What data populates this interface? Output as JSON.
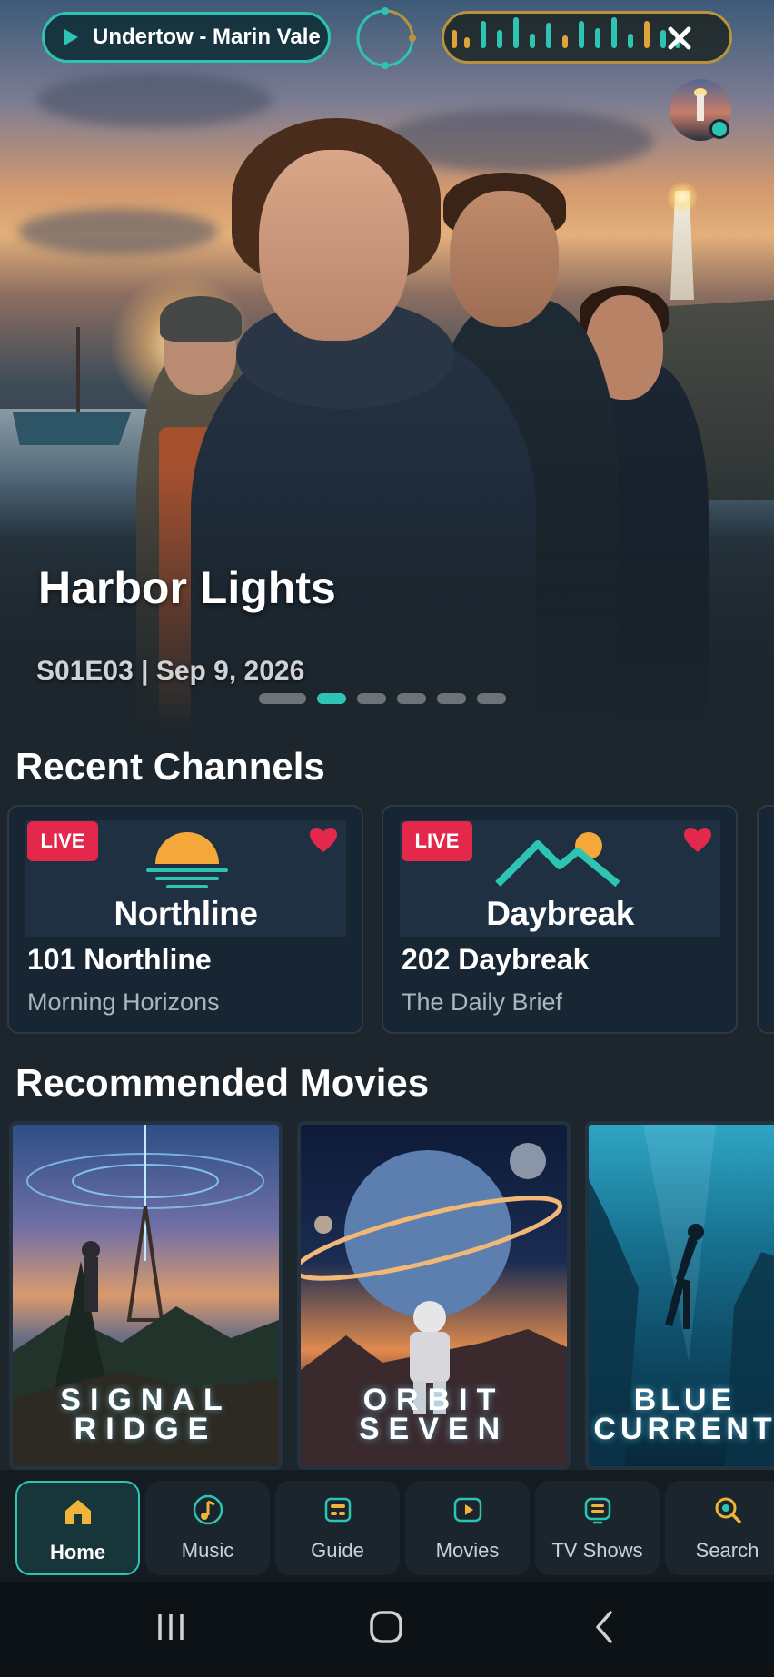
{
  "now_playing": {
    "text": "Undertow - Marin Vale",
    "accent": "#2ec4b3"
  },
  "hero": {
    "title": "Harbor Lights",
    "subtitle": "S01E03 | Sep 9, 2026",
    "carousel": {
      "count": 6,
      "active_index": 1
    }
  },
  "recent_channels": {
    "title": "Recent Channels",
    "items": [
      {
        "badge": "LIVE",
        "logo_text": "Northline",
        "number_name": "101  Northline",
        "show": "Morning Horizons",
        "favorite": true
      },
      {
        "badge": "LIVE",
        "logo_text": "Daybreak",
        "number_name": "202  Daybreak",
        "show": "The Daily Brief",
        "favorite": true
      }
    ]
  },
  "recommended_movies": {
    "title": "Recommended Movies",
    "items": [
      {
        "title_line1": "SIGNAL",
        "title_line2": "RIDGE"
      },
      {
        "title_line1": "ORBIT",
        "title_line2": "SEVEN"
      },
      {
        "title_line1": "BLUE",
        "title_line2": "CURRENT"
      }
    ]
  },
  "nav": {
    "items": [
      {
        "label": "Home",
        "icon": "home-icon",
        "active": true
      },
      {
        "label": "Music",
        "icon": "music-note-icon",
        "active": false
      },
      {
        "label": "Guide",
        "icon": "guide-icon",
        "active": false
      },
      {
        "label": "Movies",
        "icon": "movie-play-icon",
        "active": false
      },
      {
        "label": "TV Shows",
        "icon": "tv-icon",
        "active": false
      },
      {
        "label": "Search",
        "icon": "search-icon",
        "active": false
      }
    ]
  },
  "colors": {
    "accent": "#2ec4b3",
    "live": "#e4284c",
    "gold": "#b8923e"
  }
}
